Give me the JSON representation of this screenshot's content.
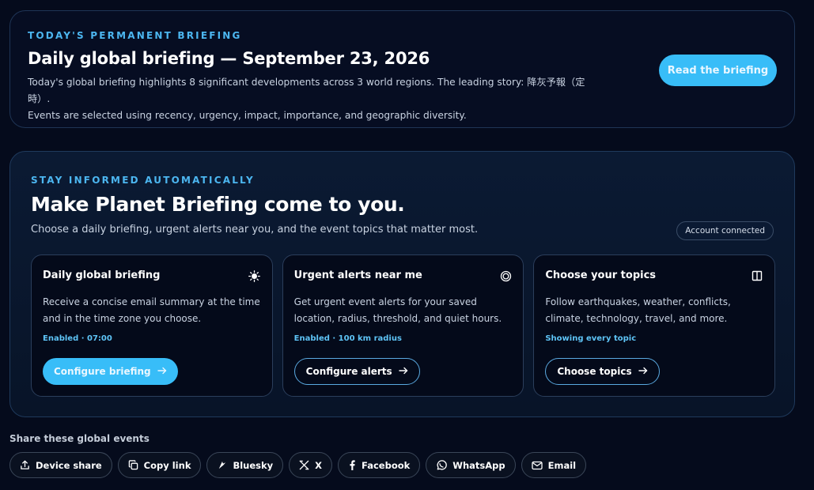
{
  "briefing": {
    "eyebrow": "TODAY'S PERMANENT BRIEFING",
    "title": "Daily global briefing — September 23, 2026",
    "text_line1": "Today's global briefing highlights 8 significant developments across 3 world regions. The leading story: 降灰予報（定時）.",
    "text_line2": "Events are selected using recency, urgency, impact, importance, and geographic diversity.",
    "read_button": "Read the briefing"
  },
  "auto": {
    "eyebrow": "STAY INFORMED AUTOMATICALLY",
    "title": "Make Planet Briefing come to you.",
    "subtitle": "Choose a daily briefing, urgent alerts near you, and the event topics that matter most.",
    "account_badge": "Account connected",
    "options": [
      {
        "title": "Daily global briefing",
        "icon": "sun-icon",
        "description": "Receive a concise email summary at the time and in the time zone you choose.",
        "status": "Enabled · 07:00",
        "button": "Configure briefing"
      },
      {
        "title": "Urgent alerts near me",
        "icon": "target-icon",
        "description": "Get urgent event alerts for your saved location, radius, threshold, and quiet hours.",
        "status": "Enabled · 100 km radius",
        "button": "Configure alerts"
      },
      {
        "title": "Choose your topics",
        "icon": "columns-icon",
        "description": "Follow earthquakes, weather, conflicts, climate, technology, travel, and more.",
        "status": "Showing every topic",
        "button": "Choose topics"
      }
    ]
  },
  "share": {
    "label": "Share these global events",
    "buttons": [
      "Device share",
      "Copy link",
      "Bluesky",
      "X",
      "Facebook",
      "WhatsApp",
      "Email"
    ]
  },
  "colors": {
    "accent": "#38bdf8",
    "eyebrow": "#4cb6f0",
    "background": "#050b1c"
  }
}
